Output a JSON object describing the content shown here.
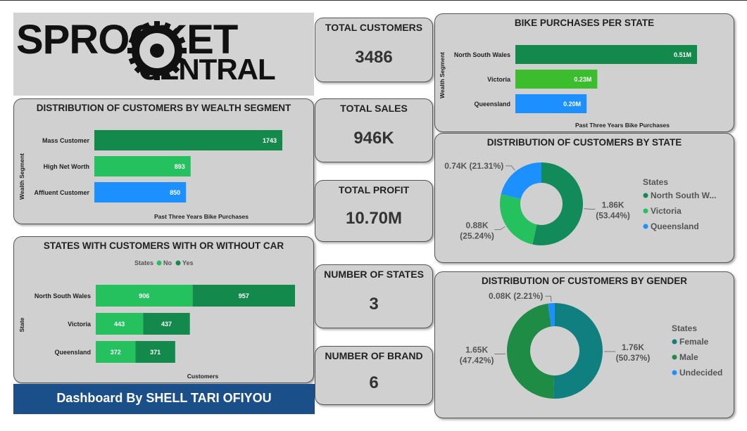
{
  "logo": {
    "line1": "SPROCKET",
    "line2": "CENTRAL"
  },
  "footer": {
    "text": "Dashboard By SHELL TARI OFIYOU"
  },
  "kpis": {
    "total_customers": {
      "label": "TOTAL CUSTOMERS",
      "value": "3486"
    },
    "total_sales": {
      "label": "TOTAL SALES",
      "value": "946K"
    },
    "total_profit": {
      "label": "TOTAL PROFIT",
      "value": "10.70M"
    },
    "number_of_states": {
      "label": "NUMBER OF STATES",
      "value": "3"
    },
    "number_of_brand": {
      "label": "NUMBER OF BRAND",
      "value": "6"
    }
  },
  "colors": {
    "dark_green": "#138a4c",
    "light_green": "#25c15f",
    "blue": "#1d90ff",
    "teal": "#0f7f7f",
    "mid_green": "#1e8c44"
  },
  "chart_data": [
    {
      "id": "wealth",
      "type": "bar",
      "title": "DISTRIBUTION OF CUSTOMERS BY WEALTH SEGMENT",
      "ylabel": "Wealth Segment",
      "xlabel": "Past Three Years Bike Purchases",
      "categories": [
        "Mass Customer",
        "High Net Worth",
        "Affluent Customer"
      ],
      "values": [
        1743,
        893,
        850
      ],
      "data_labels": [
        "1743",
        "893",
        "850"
      ],
      "bar_colors": [
        "#138a4c",
        "#25c15f",
        "#1d90ff"
      ]
    },
    {
      "id": "car",
      "type": "bar",
      "title": "STATES WITH CUSTOMERS WITH OR WITHOUT CAR",
      "legend_title": "States",
      "ylabel": "State",
      "xlabel": "Customers",
      "categories": [
        "North South Wales",
        "Victoria",
        "Queensland"
      ],
      "series": [
        {
          "name": "No",
          "values": [
            906,
            443,
            372
          ],
          "color": "#25c15f"
        },
        {
          "name": "Yes",
          "values": [
            957,
            437,
            371
          ],
          "color": "#138a4c"
        }
      ]
    },
    {
      "id": "purchases",
      "type": "bar",
      "title": "BIKE PURCHASES PER STATE",
      "ylabel": "Wealth Segment",
      "xlabel": "Past Three Years Bike Purchases",
      "categories": [
        "North South Wales",
        "Victoria",
        "Queensland"
      ],
      "values": [
        0.51,
        0.23,
        0.2
      ],
      "data_labels": [
        "0.51M",
        "0.23M",
        "0.20M"
      ],
      "bar_colors": [
        "#138a4c",
        "#3bbd2e",
        "#1d90ff"
      ]
    },
    {
      "id": "state_donut",
      "type": "pie",
      "title": "DISTRIBUTION OF CUSTOMERS BY STATE",
      "legend_title": "States",
      "categories": [
        "North South W...",
        "Victoria",
        "Queensland"
      ],
      "values": [
        1.86,
        0.88,
        0.74
      ],
      "percent": [
        53.44,
        25.24,
        21.31
      ],
      "colors": [
        "#138a5a",
        "#25c15f",
        "#1d90ff"
      ],
      "data_labels": [
        {
          "l1": "1.86K",
          "l2": "(53.44%)"
        },
        {
          "l1": "0.88K",
          "l2": "(25.24%)"
        },
        {
          "l1": "0.74K (21.31%)",
          "l2": ""
        }
      ]
    },
    {
      "id": "gender_donut",
      "type": "pie",
      "title": "DISTRIBUTION OF CUSTOMERS BY GENDER",
      "legend_title": "States",
      "categories": [
        "Female",
        "Male",
        "Undecided"
      ],
      "values": [
        1.76,
        1.65,
        0.08
      ],
      "percent": [
        50.37,
        47.42,
        2.21
      ],
      "colors": [
        "#0f7f7f",
        "#1e8c44",
        "#1d90ff"
      ],
      "data_labels": [
        {
          "l1": "1.76K",
          "l2": "(50.37%)"
        },
        {
          "l1": "1.65K",
          "l2": "(47.42%)"
        },
        {
          "l1": "0.08K (2.21%)",
          "l2": ""
        }
      ]
    }
  ]
}
